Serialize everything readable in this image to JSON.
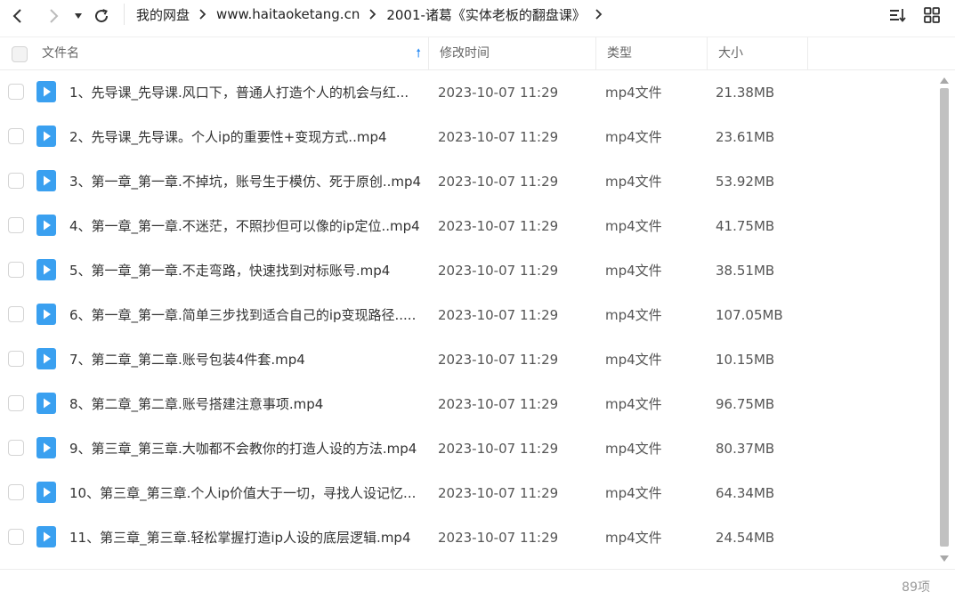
{
  "toolbar": {
    "breadcrumb": [
      "我的网盘",
      "www.haitaoketang.cn",
      "2001-诸葛《实体老板的翻盘课》"
    ]
  },
  "header": {
    "col_name": "文件名",
    "col_modified": "修改时间",
    "col_type": "类型",
    "col_size": "大小"
  },
  "colors": {
    "accent": "#2e8ef5",
    "file_icon": "#3aa0f0"
  },
  "files": [
    {
      "name": "1、先导课_先导课.风口下，普通人打造个人的机会与红...",
      "modified": "2023-10-07 11:29",
      "type": "mp4文件",
      "size": "21.38MB",
      "icon": "video-file-icon"
    },
    {
      "name": "2、先导课_先导课。个人ip的重要性+变现方式..mp4",
      "modified": "2023-10-07 11:29",
      "type": "mp4文件",
      "size": "23.61MB",
      "icon": "video-file-icon"
    },
    {
      "name": "3、第一章_第一章.不掉坑，账号生于模仿、死于原创..mp4",
      "modified": "2023-10-07 11:29",
      "type": "mp4文件",
      "size": "53.92MB",
      "icon": "video-file-icon"
    },
    {
      "name": "4、第一章_第一章.不迷茫，不照抄但可以像的ip定位..mp4",
      "modified": "2023-10-07 11:29",
      "type": "mp4文件",
      "size": "41.75MB",
      "icon": "video-file-icon"
    },
    {
      "name": "5、第一章_第一章.不走弯路，快速找到对标账号.mp4",
      "modified": "2023-10-07 11:29",
      "type": "mp4文件",
      "size": "38.51MB",
      "icon": "video-file-icon"
    },
    {
      "name": "6、第一章_第一章.简单三步找到适合自己的ip变现路径.....",
      "modified": "2023-10-07 11:29",
      "type": "mp4文件",
      "size": "107.05MB",
      "icon": "video-file-icon"
    },
    {
      "name": "7、第二章_第二章.账号包装4件套.mp4",
      "modified": "2023-10-07 11:29",
      "type": "mp4文件",
      "size": "10.15MB",
      "icon": "video-file-icon"
    },
    {
      "name": "8、第二章_第二章.账号搭建注意事项.mp4",
      "modified": "2023-10-07 11:29",
      "type": "mp4文件",
      "size": "96.75MB",
      "icon": "video-file-icon"
    },
    {
      "name": "9、第三章_第三章.大咖都不会教你的打造人设的方法.mp4",
      "modified": "2023-10-07 11:29",
      "type": "mp4文件",
      "size": "80.37MB",
      "icon": "video-file-icon"
    },
    {
      "name": "10、第三章_第三章.个人ip价值大于一切，寻找人设记忆...",
      "modified": "2023-10-07 11:29",
      "type": "mp4文件",
      "size": "64.34MB",
      "icon": "video-file-icon"
    },
    {
      "name": "11、第三章_第三章.轻松掌握打造ip人设的底层逻辑.mp4",
      "modified": "2023-10-07 11:29",
      "type": "mp4文件",
      "size": "24.54MB",
      "icon": "video-file-icon"
    }
  ],
  "footer": {
    "count": "89项"
  }
}
